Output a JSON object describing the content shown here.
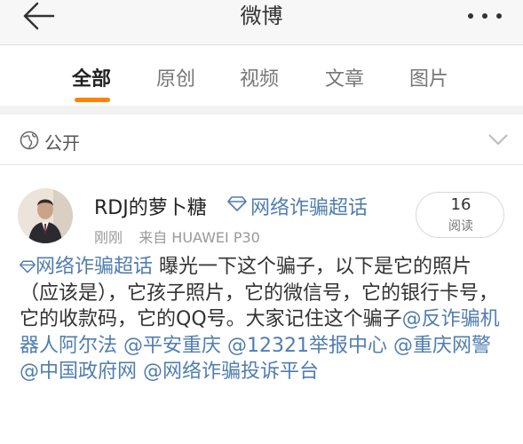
{
  "header": {
    "title": "微博",
    "back_icon": "back-arrow-icon",
    "more_icon": "more-dots-icon"
  },
  "tabs": [
    {
      "label": "全部",
      "active": true
    },
    {
      "label": "原创",
      "active": false
    },
    {
      "label": "视频",
      "active": false
    },
    {
      "label": "文章",
      "active": false
    },
    {
      "label": "图片",
      "active": false
    }
  ],
  "privacy": {
    "label": "公开",
    "icon": "globe-icon",
    "chevron": "chevron-down-icon"
  },
  "post": {
    "username": "RDJ的萝卜糖",
    "topic": "网络诈骗超话",
    "time": "刚刚",
    "source": "来自 HUAWEI P30",
    "read_count": "16",
    "read_label": "阅读",
    "body": {
      "topic": "网络诈骗超话",
      "text1": " 曝光一下这个骗子，以下是它的照片（应该是），它孩子照片，它的微信号，它的银行卡号，它的收款码，它的QQ号。大家记住这个骗子",
      "mentions": [
        "@反诈骗机器人阿尔法",
        "@平安重庆",
        "@12321举报中心",
        "@重庆网警",
        "@中国政府网",
        "@网络诈骗投诉平台"
      ]
    }
  },
  "colors": {
    "accent": "#ff8200",
    "link": "#507daf",
    "text": "#333333",
    "muted": "#999999"
  }
}
